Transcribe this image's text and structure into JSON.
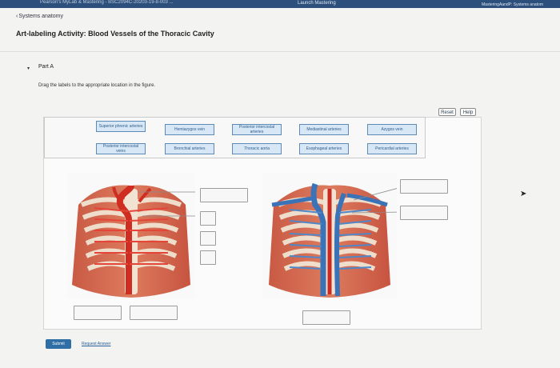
{
  "topbar": {
    "left": "Pearson's MyLab & Mastering - BSC2094C-20203-19-8-003 ...",
    "center": "Launch Mastering",
    "right": "MasteringAandP: Systems anatom"
  },
  "breadcrumb": {
    "chevron": "‹",
    "label": "Systems anatomy"
  },
  "page": {
    "title": "Art-labeling Activity: Blood Vessels of the Thoracic Cavity"
  },
  "part": {
    "toggle": "▾",
    "label": "Part A"
  },
  "instructions": "Drag the labels to the appropriate location in the figure.",
  "controls": {
    "reset": "Reset",
    "help": "Help"
  },
  "labels": [
    {
      "name": "superior-phrenic-arteries-label",
      "text": "Superior phrenic arteries"
    },
    {
      "name": "hemiazygos-vein-label",
      "text": "Hemiazygos vein"
    },
    {
      "name": "posterior-intercostal-arteries-label",
      "text": "Posterior intercostal arteries"
    },
    {
      "name": "mediastinal-arteries-label",
      "text": "Mediastinal arteries"
    },
    {
      "name": "azygos-vein-label",
      "text": "Azygos vein"
    },
    {
      "name": "posterior-intercostal-veins-label",
      "text": "Posterior intercostal veins"
    },
    {
      "name": "bronchial-arteries-label",
      "text": "Bronchial arteries"
    },
    {
      "name": "thoracic-aorta-label",
      "text": "Thoracic aorta"
    },
    {
      "name": "esophageal-arteries-label",
      "text": "Esophageal arteries"
    },
    {
      "name": "pericardial-arteries-label",
      "text": "Pericardial arteries"
    }
  ],
  "footer": {
    "submit": "Submit",
    "request_answer": "Request Answer"
  },
  "colors": {
    "topbar": "#2c4f7c",
    "label_fill": "#d7e7f6",
    "label_border": "#5d8bb5",
    "submit": "#2f6fa5",
    "artery_red": "#d43b2f",
    "vein_blue": "#3a73b7"
  }
}
